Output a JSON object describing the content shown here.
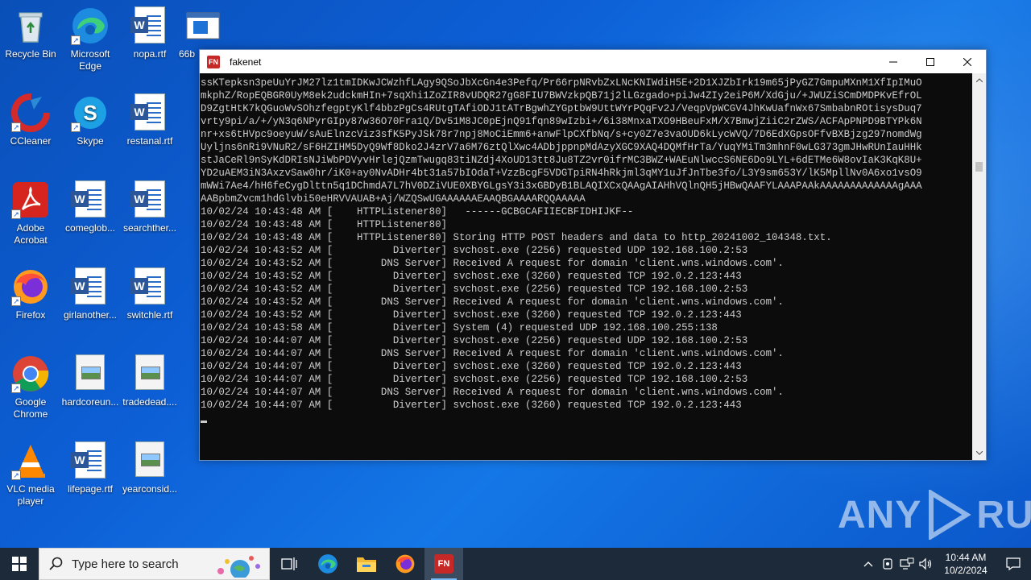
{
  "desktop": {
    "icons": [
      {
        "label": "Recycle Bin",
        "icon": "recycle-bin-icon"
      },
      {
        "label": "Microsoft Edge",
        "icon": "edge-icon"
      },
      {
        "label": "nopa.rtf",
        "icon": "word-document-icon"
      },
      {
        "label": "66b",
        "icon": "window-app-icon"
      },
      {
        "label": "CCleaner",
        "icon": "ccleaner-icon"
      },
      {
        "label": "Skype",
        "icon": "skype-icon"
      },
      {
        "label": "restanal.rtf",
        "icon": "word-document-icon"
      },
      {
        "label": "Adobe Acrobat",
        "icon": "acrobat-icon"
      },
      {
        "label": "comeglob...",
        "icon": "word-document-icon"
      },
      {
        "label": "searchther...",
        "icon": "word-document-icon"
      },
      {
        "label": "Firefox",
        "icon": "firefox-icon"
      },
      {
        "label": "girlanother...",
        "icon": "word-document-icon"
      },
      {
        "label": "switchle.rtf",
        "icon": "word-document-icon"
      },
      {
        "label": "Google Chrome",
        "icon": "chrome-icon"
      },
      {
        "label": "hardcoreun...",
        "icon": "image-file-icon"
      },
      {
        "label": "tradedead....",
        "icon": "image-file-icon"
      },
      {
        "label": "VLC media player",
        "icon": "vlc-icon"
      },
      {
        "label": "lifepage.rtf",
        "icon": "word-document-icon"
      },
      {
        "label": "yearconsid...",
        "icon": "image-file-icon"
      }
    ]
  },
  "window": {
    "title": "fakenet",
    "app_badge": "FN",
    "console_lines": [
      "ssKTepksn3peUuYrJM27lz1tmIDKwJCWzhfLAgy9QSoJbXcGn4e3Pefq/Pr66rpNRvbZxLNcKNIWdiH5E+2D1XJZbIrk19m65jPyGZ7GmpuMXnM1XfIpIMuO",
      "mkphZ/RopEQBGR0UyM8ek2udckmHIn+7sqXhi1ZoZIR8vUDQR27gG8FIU7BWVzkpQB71j2lLGzgado+piJw4ZIy2eiP6M/XdGju/+JWUZiSCmDMDPKvEfrOL",
      "D9ZgtHtK7kQGuoWvSOhzfegptyKlf4bbzPgCs4RUtgTAfiODJ1tATrBgwhZYGptbW9UttWYrPQqFv2J/VeqpVpWCGV4JhKwUafnWx67SmbabnROtisysDuq7",
      "vrty9pi/a/+/yN3q6NPyrGIpy87w36O70Fra1Q/Dv51M8JC0pEjnQ91fqn89wIzbi+/6i38MnxaTXO9HBeuFxM/X7BmwjZiiC2rZWS/ACFApPNPD9BTYPk6N",
      "nr+xs6tHVpc9oeyuW/sAuElnzcViz3sfK5PyJSk78r7npj8MoCiEmm6+anwFlpCXfbNq/s+cy0Z7e3vaOUD6kLycWVQ/7D6EdXGpsOFfvBXBjzg297nomdWg",
      "Uyljns6nRi9VNuR2/sF6HZIHM5DyQ9Wf8Dko2J4zrV7a6M76ztQlXwc4ADbjppnpMdAzyXGC9XAQ4DQMfHrTa/YuqYMiTm3mhnF0wLG373gmJHwRUnIauHHk",
      "stJaCeRl9nSyKdDRIsNJiWbPDVyvHrlejQzmTwugq83tiNZdj4XoUD13tt8Ju8TZ2vr0ifrMC3BWZ+WAEuNlwccS6NE6Do9LYL+6dETMe6W8ovIaK3KqK8U+",
      "YD2uAEM3iN3AxzvSaw0hr/iK0+ay0NvADHr4bt31a57bIOdaT+VzzBcgF5VDGTpiRN4hRkjml3qMY1uJfJnTbe3fo/L3Y9sm653Y/lK5MpllNv0A6xo1vsO9",
      "mWWi7Ae4/hH6feCygDlttn5q1DChmdA7L7hV0DZiVUE0XBYGLgsY3i3xGBDyB1BLAQIXCxQAAgAIAHhVQlnQH5jHBwQAAFYLAAAPAAkAAAAAAAAAAAAAgAAA",
      "AABpbmZvcm1hdGlvbi50eHRVVAUAB+Aj/WZQSwUGAAAAAAEAAQBGAAAARQQAAAAA",
      "10/02/24 10:43:48 AM [    HTTPListener80]   ------GCBGCAFIIECBFIDHIJKF--",
      "10/02/24 10:43:48 AM [    HTTPListener80]",
      "10/02/24 10:43:48 AM [    HTTPListener80] Storing HTTP POST headers and data to http_20241002_104348.txt.",
      "10/02/24 10:43:52 AM [          Diverter] svchost.exe (2256) requested UDP 192.168.100.2:53",
      "10/02/24 10:43:52 AM [        DNS Server] Received A request for domain 'client.wns.windows.com'.",
      "10/02/24 10:43:52 AM [          Diverter] svchost.exe (3260) requested TCP 192.0.2.123:443",
      "10/02/24 10:43:52 AM [          Diverter] svchost.exe (2256) requested TCP 192.168.100.2:53",
      "10/02/24 10:43:52 AM [        DNS Server] Received A request for domain 'client.wns.windows.com'.",
      "10/02/24 10:43:52 AM [          Diverter] svchost.exe (3260) requested TCP 192.0.2.123:443",
      "10/02/24 10:43:58 AM [          Diverter] System (4) requested UDP 192.168.100.255:138",
      "10/02/24 10:44:07 AM [          Diverter] svchost.exe (2256) requested UDP 192.168.100.2:53",
      "10/02/24 10:44:07 AM [        DNS Server] Received A request for domain 'client.wns.windows.com'.",
      "10/02/24 10:44:07 AM [          Diverter] svchost.exe (3260) requested TCP 192.0.2.123:443",
      "10/02/24 10:44:07 AM [          Diverter] svchost.exe (2256) requested TCP 192.168.100.2:53",
      "10/02/24 10:44:07 AM [        DNS Server] Received A request for domain 'client.wns.windows.com'.",
      "10/02/24 10:44:07 AM [          Diverter] svchost.exe (3260) requested TCP 192.0.2.123:443"
    ]
  },
  "watermark": {
    "left": "ANY",
    "right": "RUN"
  },
  "taskbar": {
    "search_placeholder": "Type here to search",
    "apps": [
      "task-view",
      "edge",
      "file-explorer",
      "firefox",
      "fakenet"
    ],
    "clock_time": "10:44 AM",
    "clock_date": "10/2/2024"
  },
  "colors": {
    "console_bg": "#0c0c0c",
    "console_fg": "#cccccc",
    "taskbar_bg": "#1c2a3a",
    "desktop_blue": "#0d5fd6"
  }
}
